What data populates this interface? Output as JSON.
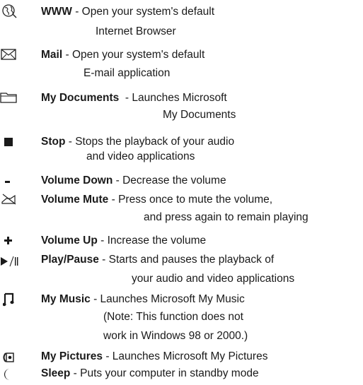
{
  "items": [
    {
      "icon": "globe-icon",
      "name": "WWW",
      "sep": " - ",
      "desc": "Open your system's default",
      "cont": [
        "Internet Browser"
      ]
    },
    {
      "icon": "envelope-icon",
      "name": "Mail",
      "sep": " - ",
      "desc": "Open your system's default",
      "cont": [
        "E-mail application"
      ]
    },
    {
      "icon": "folder-icon",
      "name": "My Documents",
      "sep": "  - ",
      "desc": "Launches Microsoft",
      "cont": [
        "My Documents"
      ]
    },
    {
      "icon": "stop-icon",
      "name": "Stop",
      "sep": " - ",
      "desc": "Stops the playback of your audio",
      "cont": [
        "and video applications"
      ]
    },
    {
      "icon": "minus-icon",
      "name": "Volume Down",
      "sep": " - ",
      "desc": "Decrease the volume",
      "cont": []
    },
    {
      "icon": "mute-icon",
      "name": "Volume Mute",
      "sep": " - ",
      "desc": "Press once to mute the volume,",
      "cont": [
        "and press again to remain playing"
      ]
    },
    {
      "icon": "plus-icon",
      "name": "Volume Up",
      "sep": " - ",
      "desc": "Increase the volume",
      "cont": []
    },
    {
      "icon": "play-pause-icon",
      "name": "Play/Pause",
      "sep": " - ",
      "desc": "Starts and pauses the playback of",
      "cont": [
        "your audio and video applications"
      ]
    },
    {
      "icon": "music-note-icon",
      "name": "My Music",
      "sep": " - ",
      "desc": "Launches Microsoft My Music",
      "cont": [
        "(Note: This function does not",
        "work in Windows 98 or 2000.)"
      ]
    },
    {
      "icon": "pictures-icon",
      "name": "My Pictures",
      "sep": " - ",
      "desc": "Launches Microsoft My Pictures",
      "cont": []
    },
    {
      "icon": "moon-icon",
      "name": "Sleep",
      "sep": " - ",
      "desc": "Puts your computer in standby mode",
      "cont": []
    }
  ]
}
